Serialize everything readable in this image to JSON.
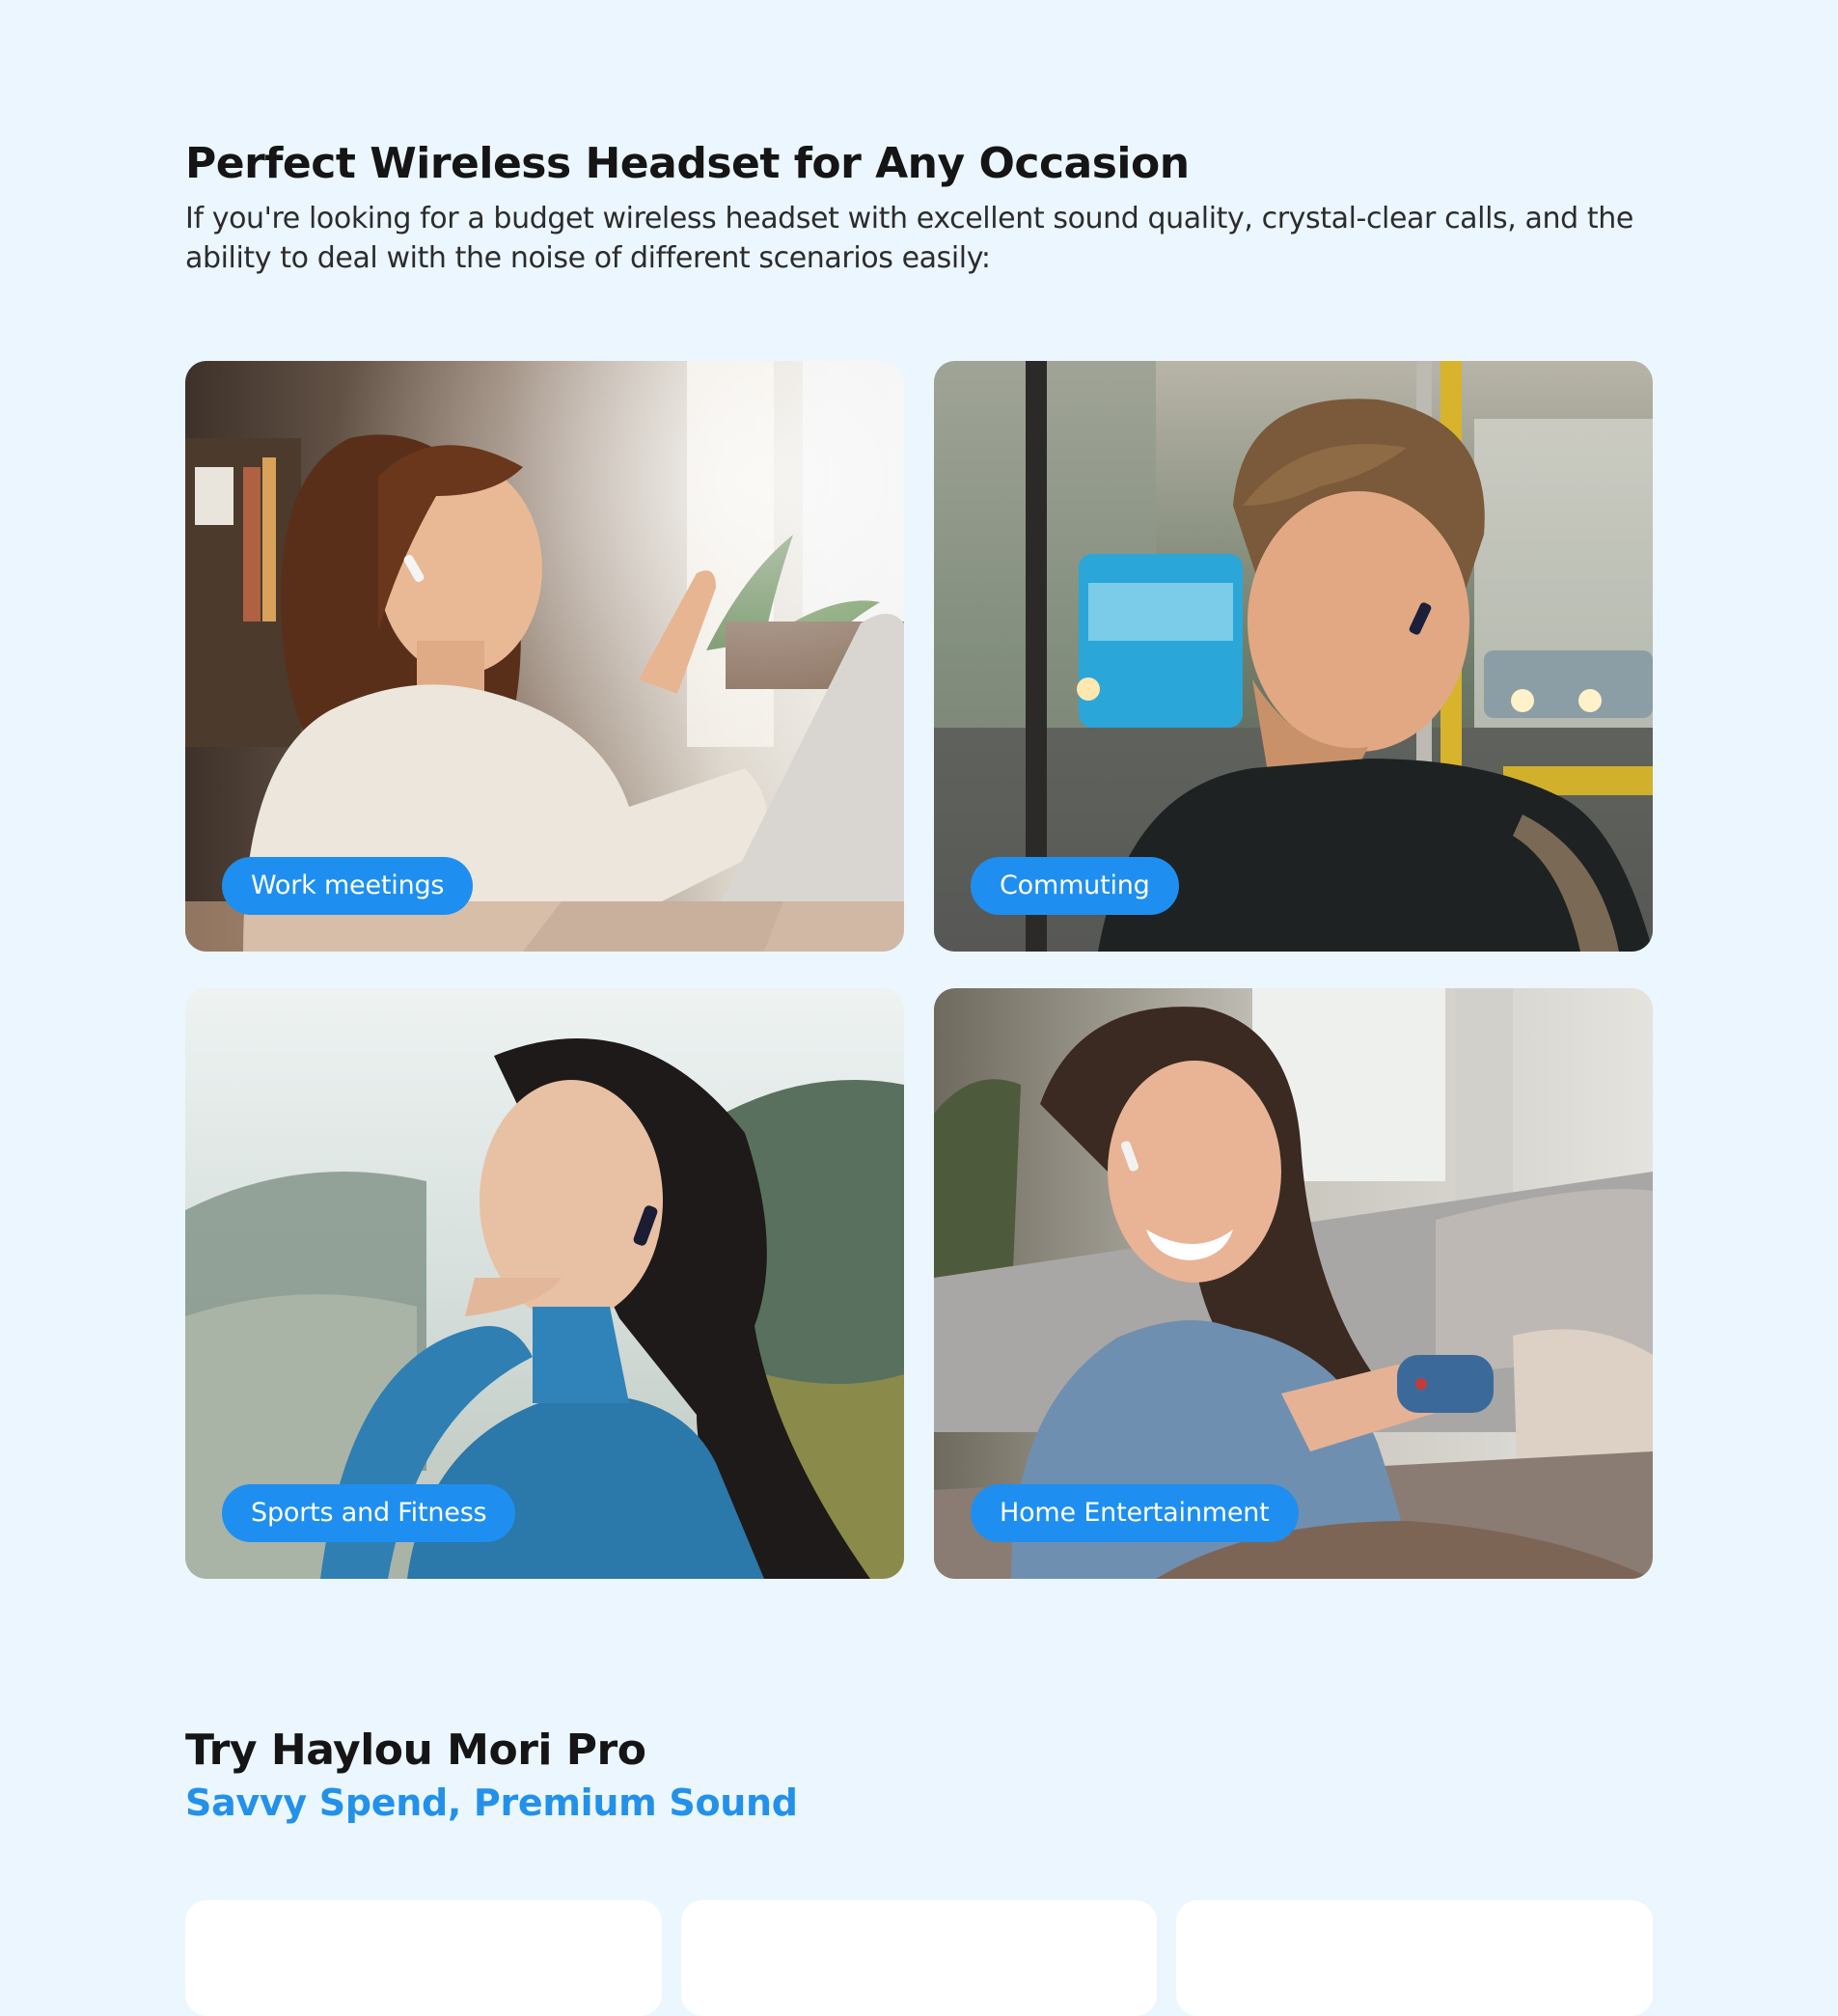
{
  "occasion": {
    "title": "Perfect Wireless Headset for Any Occasion",
    "description": "If you're looking for a budget wireless headset with excellent sound quality, crystal-clear calls, and the ability to deal with the noise of different scenarios easily:",
    "cards": [
      {
        "label": "Work meetings",
        "image": "woman-with-laptop-photo"
      },
      {
        "label": "Commuting",
        "image": "man-on-bus-photo"
      },
      {
        "label": "Sports and Fitness",
        "image": "woman-outdoors-photo"
      },
      {
        "label": "Home Entertainment",
        "image": "woman-gaming-on-couch-photo"
      }
    ]
  },
  "try_section": {
    "title": "Try Haylou Mori Pro",
    "subtitle": "Savvy Spend, Premium Sound"
  },
  "colors": {
    "background": "#ebf6fe",
    "accent": "#1e8ff0",
    "subtitle": "#2391ea",
    "heading": "#151515"
  }
}
